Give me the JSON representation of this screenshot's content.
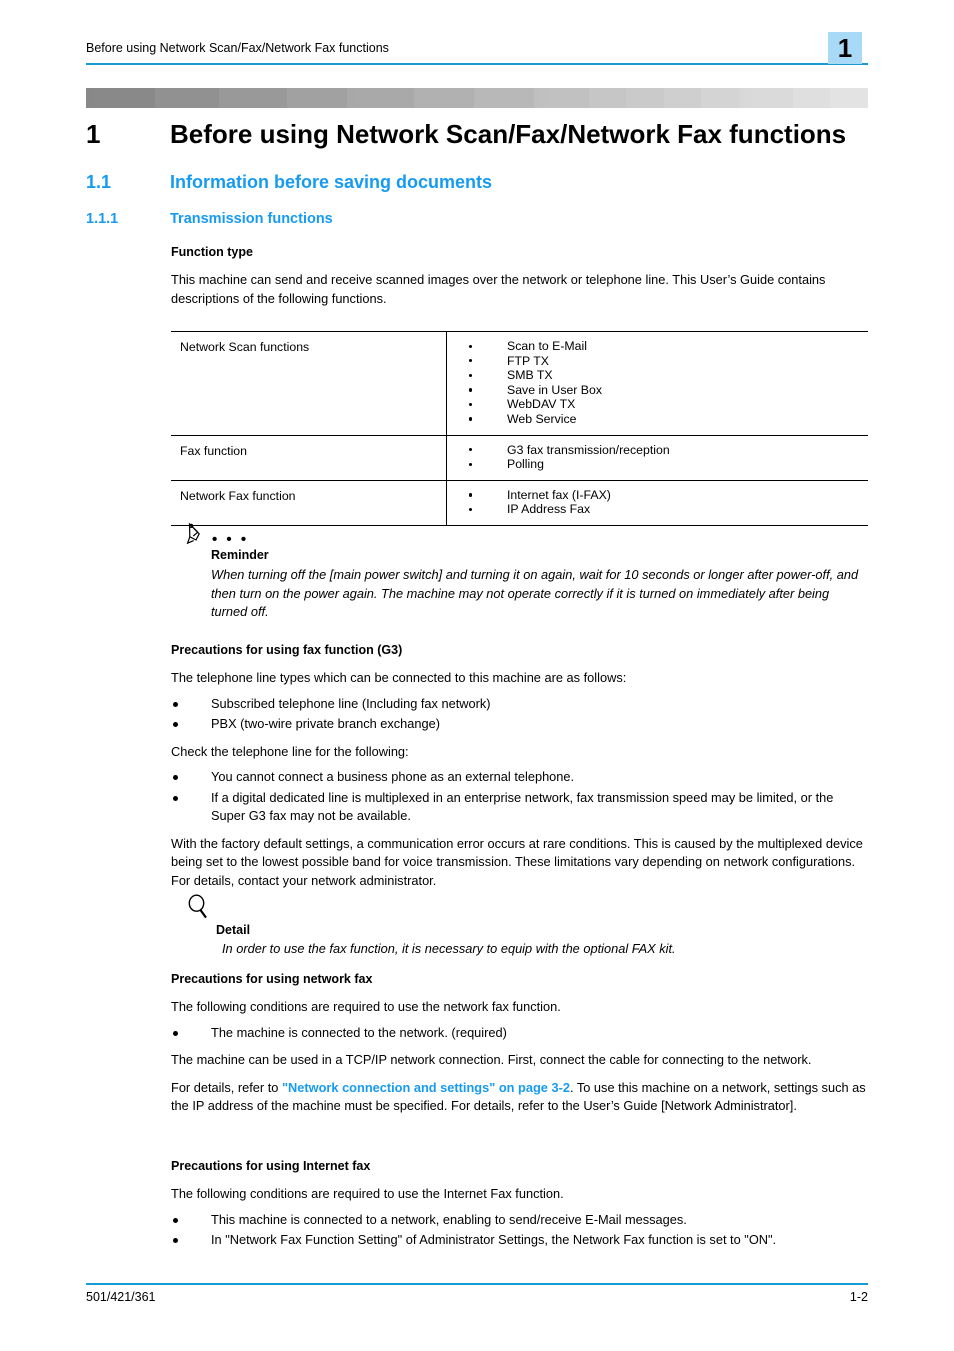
{
  "header": {
    "running_title": "Before using Network Scan/Fax/Network Fax functions",
    "chapter_number": "1",
    "rule_color": "#169bd5",
    "chapter_box_color": "#a8d9f7"
  },
  "headings": {
    "h1_number": "1",
    "h1_title": "Before using Network Scan/Fax/Network Fax functions",
    "h2_number": "1.1",
    "h2_title": "Information before saving documents",
    "h3_number": "1.1.1",
    "h3_title": "Transmission functions",
    "accent_color": "#179bf2"
  },
  "function_type": {
    "heading": "Function type",
    "intro": "This machine can send and receive scanned images over the network or telephone line. This User’s Guide contains descriptions of the following functions."
  },
  "function_table": {
    "rows": [
      {
        "label": "Network Scan functions",
        "items": [
          "Scan to E-Mail",
          "FTP TX",
          "SMB TX",
          "Save in User Box",
          "WebDAV TX",
          "Web Service"
        ]
      },
      {
        "label": "Fax function",
        "items": [
          "G3 fax transmission/reception",
          "Polling"
        ]
      },
      {
        "label": "Network Fax function",
        "items": [
          "Internet fax (I-FAX)",
          "IP Address Fax"
        ]
      }
    ]
  },
  "reminder": {
    "icon": "pencil-icon",
    "dots": "• • •",
    "title": "Reminder",
    "body": "When turning off the [main power switch] and turning it on again, wait for 10 seconds or longer after power-off, and then turn on the power again. The machine may not operate correctly if it is turned on immediately after being turned off."
  },
  "fax_g3": {
    "heading": "Precautions for using fax function (G3)",
    "intro": "The telephone line types which can be connected to this machine are as follows:",
    "line_types": [
      "Subscribed telephone line (Including fax network)",
      "PBX (two-wire private branch exchange)"
    ],
    "check_intro": "Check the telephone line for the following:",
    "checks": [
      "You cannot connect a business phone as an external telephone.",
      "If a digital dedicated line is multiplexed in an enterprise network, fax transmission speed may be limited, or the Super G3 fax may not be available."
    ],
    "closing": "With the factory default settings, a communication error occurs at rare conditions. This is caused by the multiplexed device being set to the lowest possible band for voice transmission. These limitations vary depending on network configurations. For details, contact your network administrator."
  },
  "detail": {
    "icon": "magnifier-icon",
    "title": "Detail",
    "body": "In order to use the fax function, it is necessary to equip with the optional FAX kit."
  },
  "network_fax": {
    "heading": "Precautions for using network fax",
    "intro": "The following conditions are required to use the network fax function.",
    "bullets": [
      "The machine is connected to the network. (required)"
    ],
    "para2": "The machine can be used in a TCP/IP network connection. First, connect the cable for connecting to the network.",
    "para3_before": "For details, refer to ",
    "para3_link": "\"Network connection and settings\" on page 3-2",
    "para3_after": ". To use this machine on a network, settings such as the IP address of the machine must be specified. For details, refer to the User’s Guide [Network Administrator]."
  },
  "internet_fax": {
    "heading": "Precautions for using Internet fax",
    "intro": "The following conditions are required to use the Internet Fax function.",
    "bullets": [
      "This machine is connected to a network, enabling to send/receive E-Mail messages.",
      "In \"Network Fax Function Setting\" of Administrator Settings, the Network Fax function is set to \"ON\"."
    ]
  },
  "footer": {
    "model": "501/421/361",
    "page": "1-2"
  }
}
